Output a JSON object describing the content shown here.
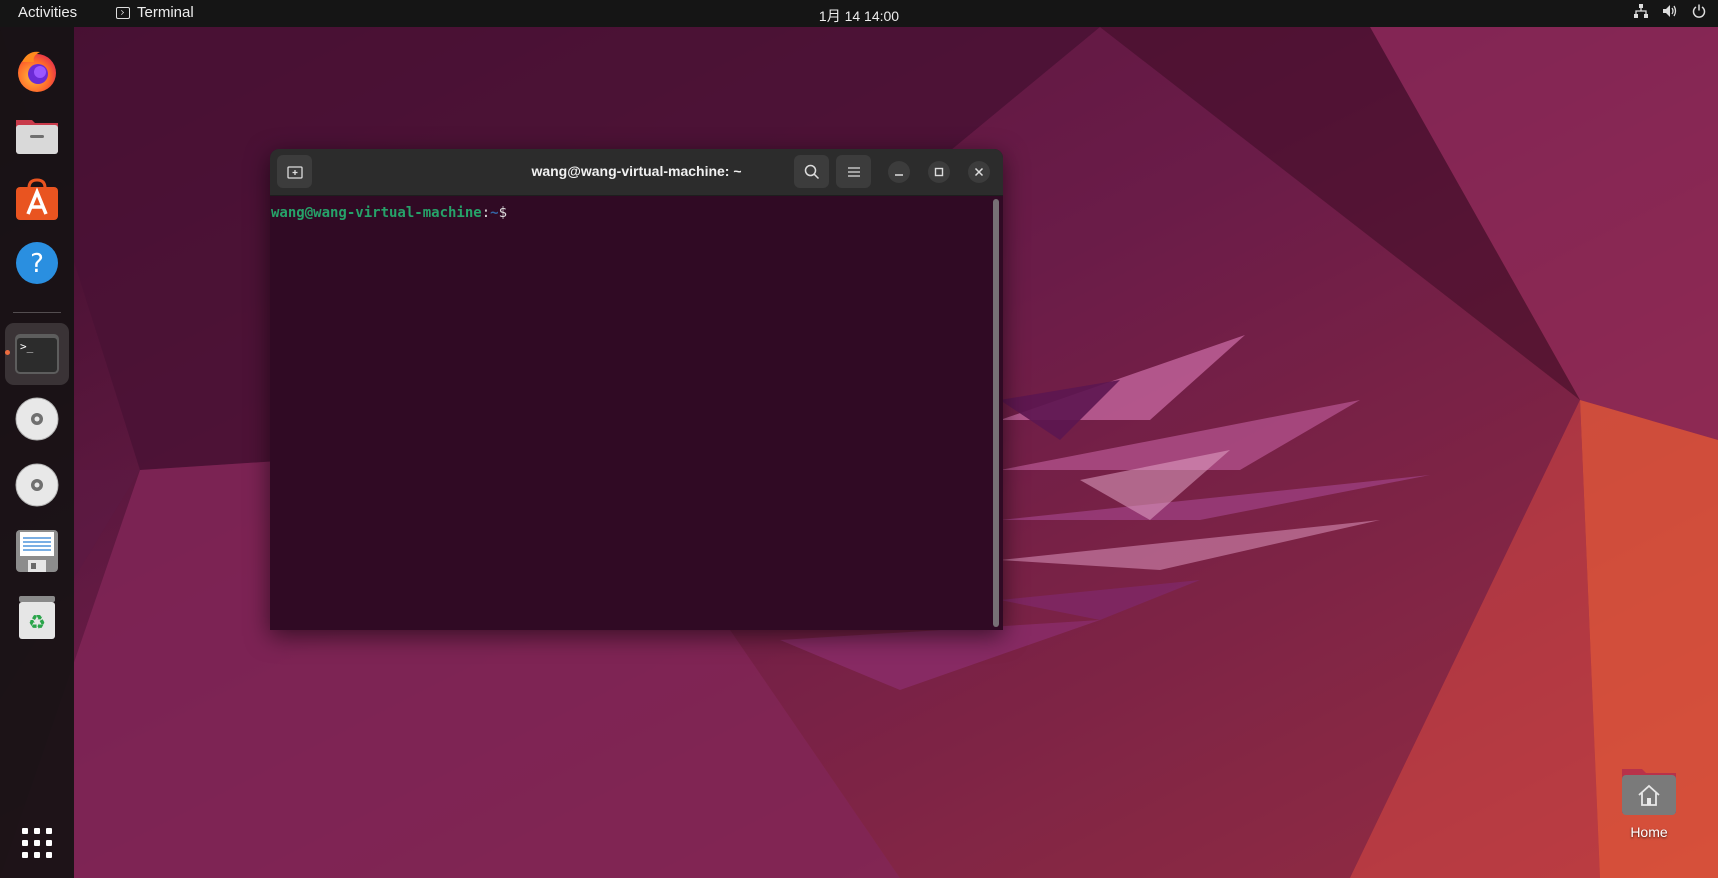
{
  "topbar": {
    "activities_label": "Activities",
    "app_name": "Terminal",
    "clock": "1月 14  14:00",
    "tray_icons": [
      "network-icon",
      "volume-icon",
      "power-icon"
    ]
  },
  "dock": {
    "items": [
      {
        "name": "firefox",
        "icon": "firefox-icon"
      },
      {
        "name": "files",
        "icon": "files-icon"
      },
      {
        "name": "app-center",
        "icon": "app-store-icon"
      },
      {
        "name": "help",
        "icon": "help-icon"
      },
      {
        "name": "terminal",
        "icon": "terminal-icon",
        "running": true
      },
      {
        "name": "disc-1",
        "icon": "cd-icon"
      },
      {
        "name": "disc-2",
        "icon": "cd-icon"
      },
      {
        "name": "text-editor",
        "icon": "document-icon"
      },
      {
        "name": "trash",
        "icon": "trash-icon"
      }
    ],
    "show_apps_icon": "app-grid-icon"
  },
  "terminal": {
    "title": "wang@wang-virtual-machine: ~",
    "prompt_user": "wang@wang-virtual-machine",
    "prompt_colon": ":",
    "prompt_path": "~",
    "prompt_symbol": "$",
    "colors": {
      "background": "#300a24",
      "user": "#26a269",
      "path": "#3465a4"
    }
  },
  "desktop": {
    "home_label": "Home"
  },
  "colors": {
    "accent": "#e95420",
    "topbar": "#151515"
  }
}
